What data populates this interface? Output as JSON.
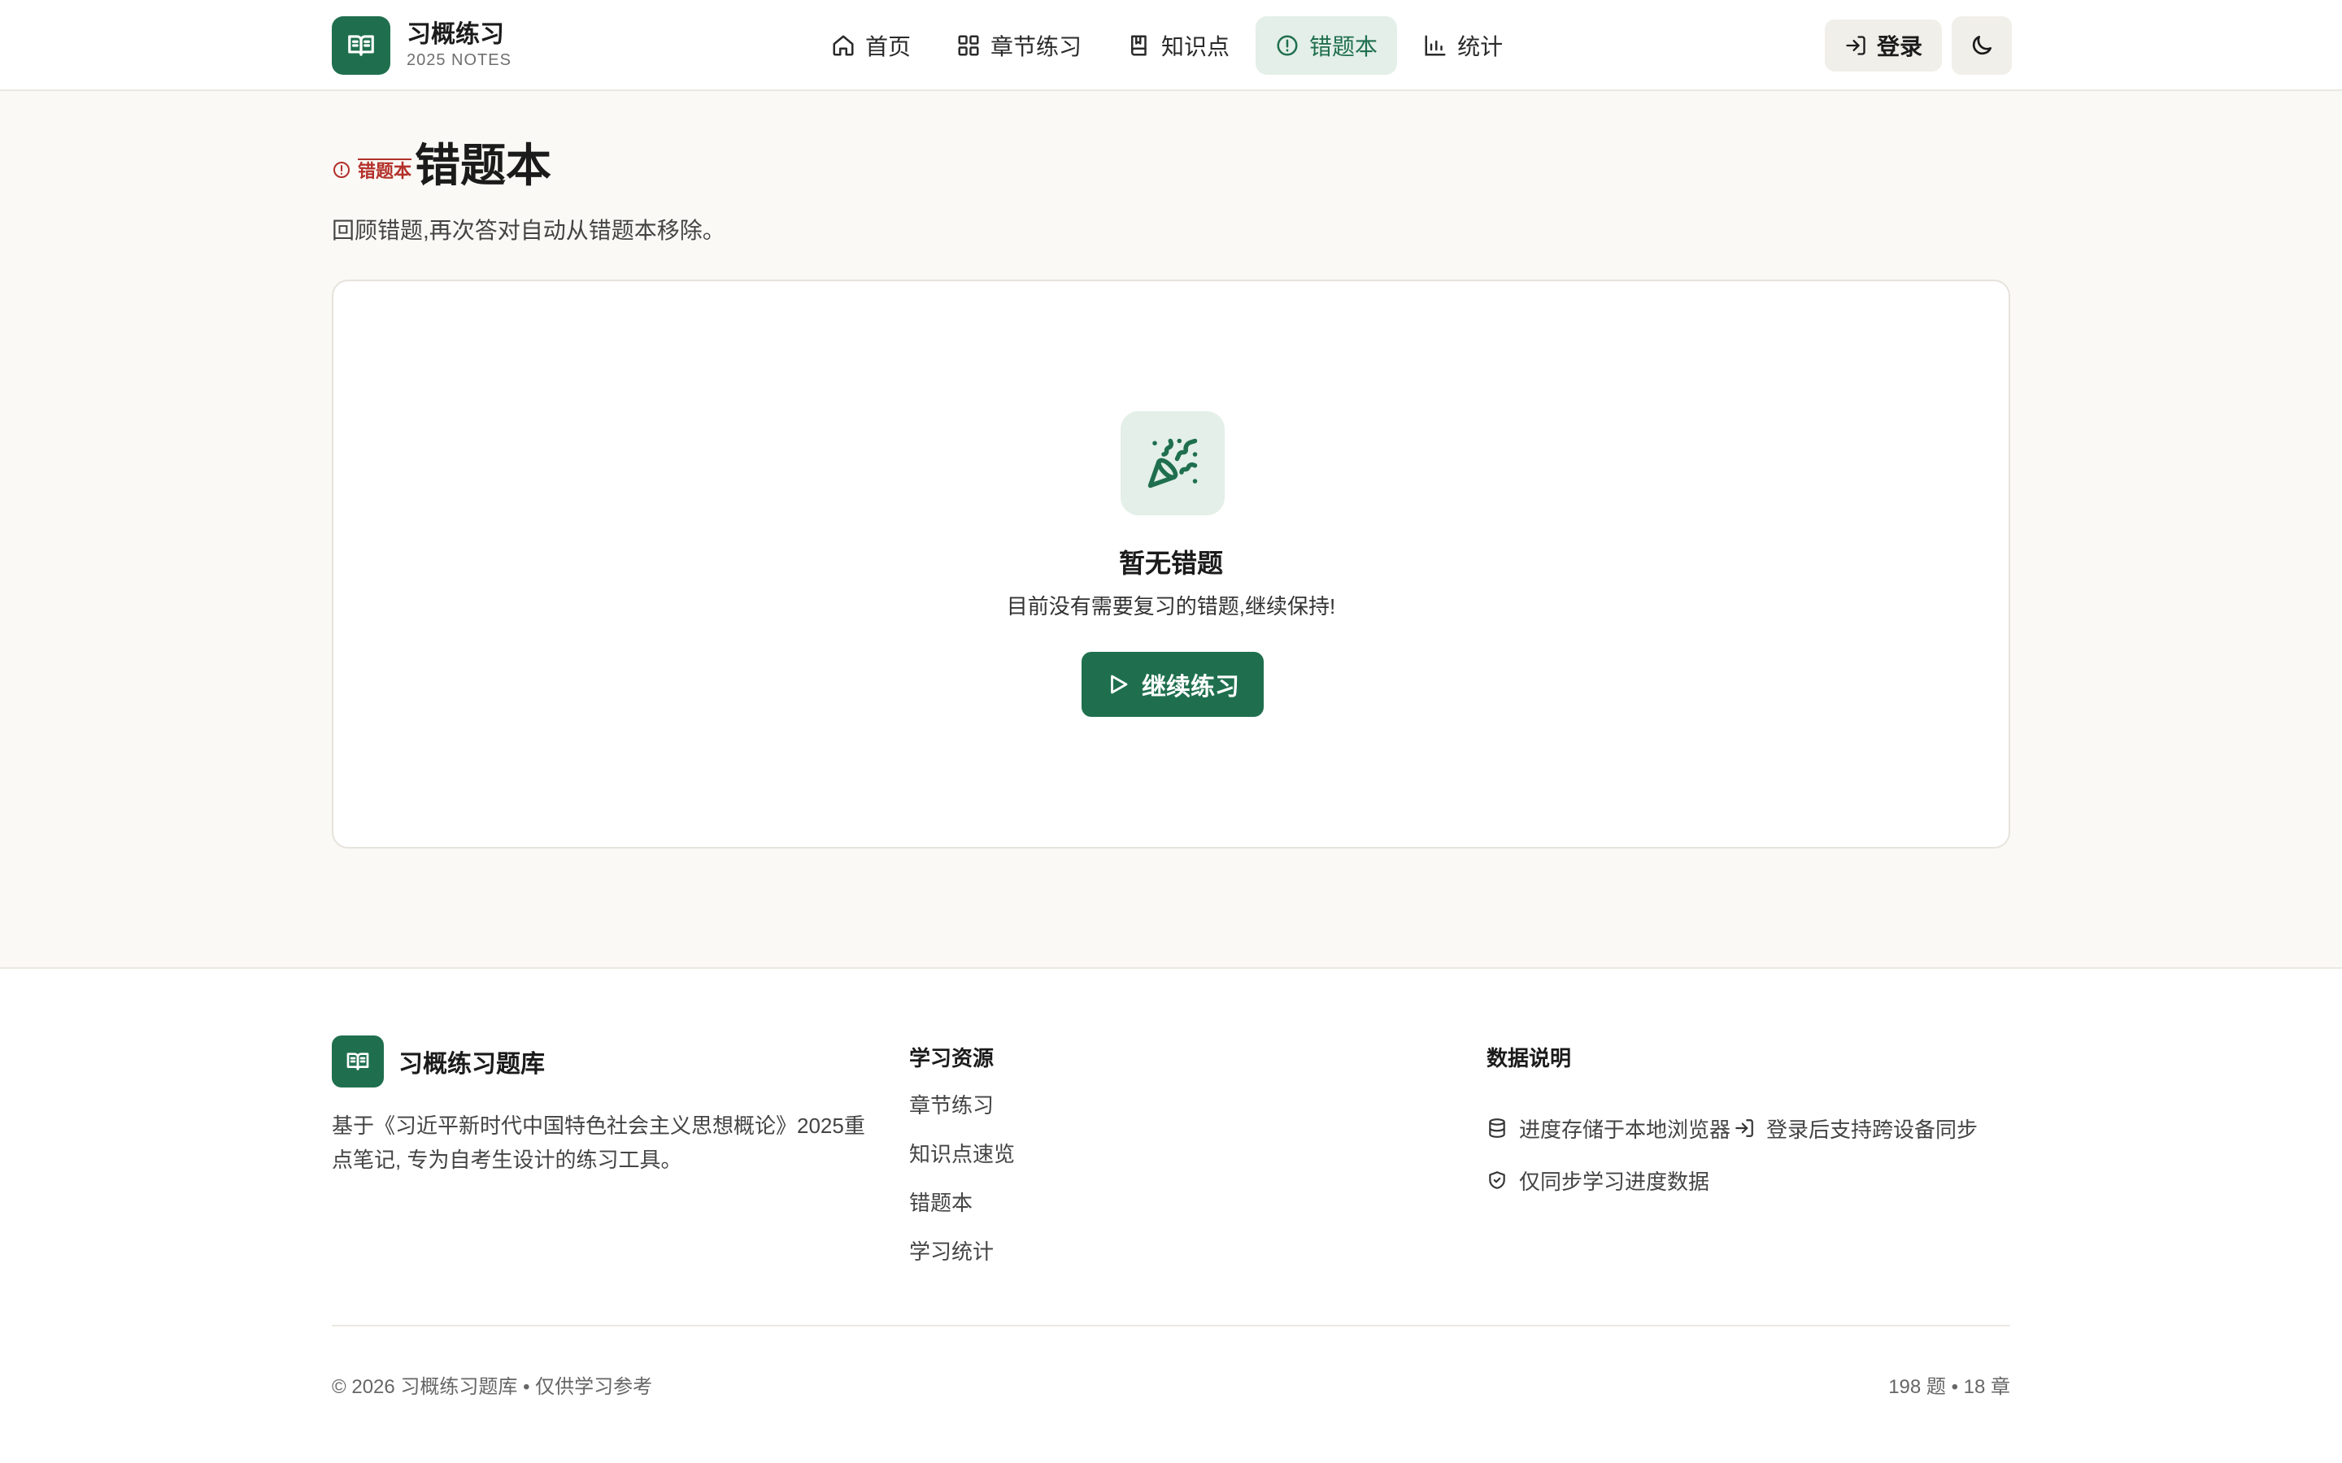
{
  "brand": {
    "title": "习概练习",
    "subtitle": "2025 NOTES"
  },
  "nav": [
    {
      "label": "首页",
      "icon": "home-icon"
    },
    {
      "label": "章节练习",
      "icon": "grid-icon"
    },
    {
      "label": "知识点",
      "icon": "book-icon"
    },
    {
      "label": "错题本",
      "icon": "alert-circle-icon",
      "active": true
    },
    {
      "label": "统计",
      "icon": "bar-chart-icon"
    }
  ],
  "header": {
    "login_label": "登录",
    "theme_toggle": "moon-icon"
  },
  "page": {
    "tag": "错题本",
    "title": "错题本",
    "subtitle": "回顾错题,再次答对自动从错题本移除。"
  },
  "empty": {
    "icon": "party-popper-icon",
    "title": "暂无错题",
    "desc": "目前没有需要复习的错题,继续保持!",
    "button_label": "继续练习"
  },
  "footer": {
    "brand_name": "习概练习题库",
    "description": "基于《习近平新时代中国特色社会主义思想概论》2025重点笔记, 专为自考生设计的练习工具。",
    "resources_title": "学习资源",
    "resources": [
      "章节练习",
      "知识点速览",
      "错题本",
      "学习统计"
    ],
    "data_title": "数据说明",
    "data_items": [
      {
        "icon": "database-icon",
        "text": "进度存储于本地浏览器",
        "login_icon": "login-icon",
        "suffix": "登录后支持跨设备同步"
      },
      {
        "icon": "shield-check-icon",
        "text": "仅同步学习进度数据"
      }
    ],
    "copyright": "© 2026 习概练习题库 • 仅供学习参考",
    "stats": "198 题 • 18 章"
  },
  "colors": {
    "primary": "#1f6f4e",
    "primary_light": "#e3efe8",
    "danger": "#b3302a",
    "background": "#faf9f5"
  }
}
